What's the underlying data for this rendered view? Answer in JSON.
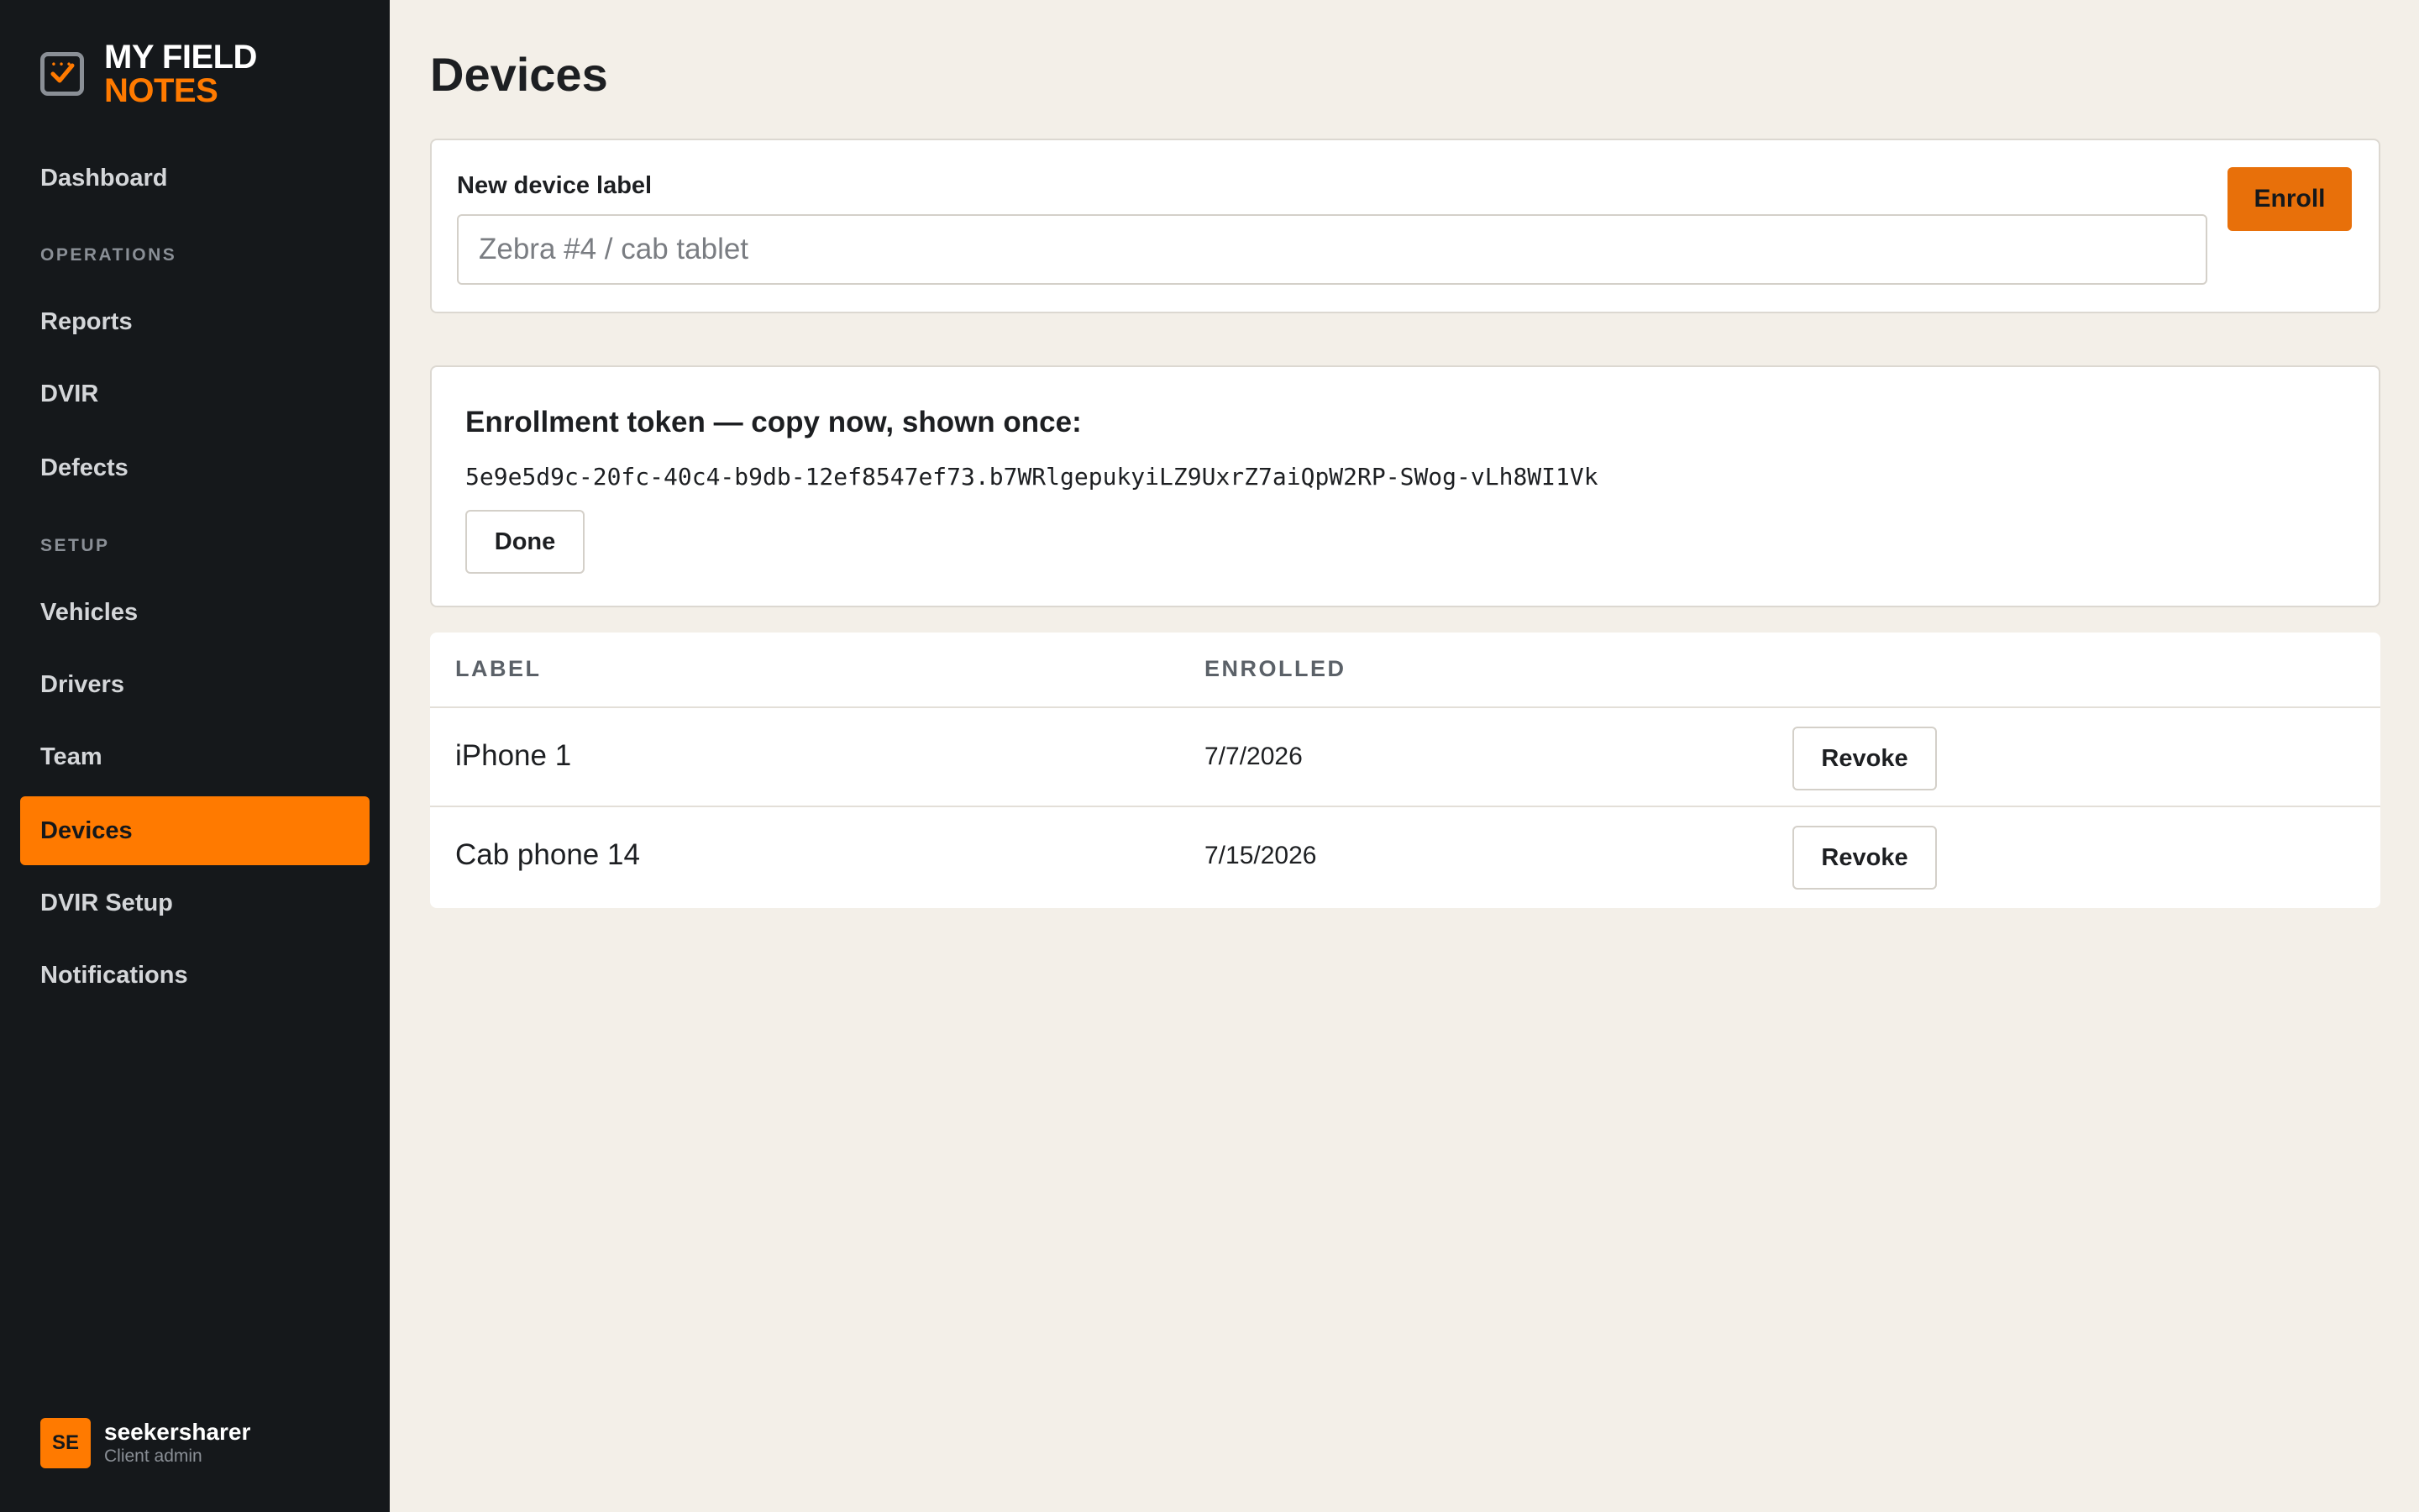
{
  "brand": {
    "line1": "MY FIELD",
    "line2": "NOTES",
    "icon": "checkbox-icon"
  },
  "sidebar": {
    "items": [
      {
        "label": "Dashboard"
      },
      {
        "section": "OPERATIONS"
      },
      {
        "label": "Reports"
      },
      {
        "label": "DVIR"
      },
      {
        "label": "Defects"
      },
      {
        "section": "SETUP"
      },
      {
        "label": "Vehicles"
      },
      {
        "label": "Drivers"
      },
      {
        "label": "Team"
      },
      {
        "label": "Devices",
        "active": true
      },
      {
        "label": "DVIR Setup"
      },
      {
        "label": "Notifications"
      }
    ]
  },
  "user": {
    "initials": "SE",
    "name": "seekersharer",
    "role": "Client admin"
  },
  "page": {
    "title": "Devices"
  },
  "enroll": {
    "field_label": "New device label",
    "placeholder": "Zebra #4 / cab tablet",
    "value": "",
    "button": "Enroll"
  },
  "token": {
    "title": "Enrollment token — copy now, shown once:",
    "value": "5e9e5d9c-20fc-40c4-b9db-12ef8547ef73.b7WRlgepukyiLZ9UxrZ7aiQpW2RP-SWog-vLh8WI1Vk",
    "done_button": "Done"
  },
  "devices_table": {
    "columns": [
      "LABEL",
      "ENROLLED"
    ],
    "rows": [
      {
        "label": "iPhone 1",
        "enrolled": "7/7/2026",
        "action": "Revoke"
      },
      {
        "label": "Cab phone 14",
        "enrolled": "7/15/2026",
        "action": "Revoke"
      }
    ]
  },
  "colors": {
    "accent": "#ff7a00",
    "sidebar_bg": "#15181b",
    "page_bg": "#f3efe8"
  }
}
